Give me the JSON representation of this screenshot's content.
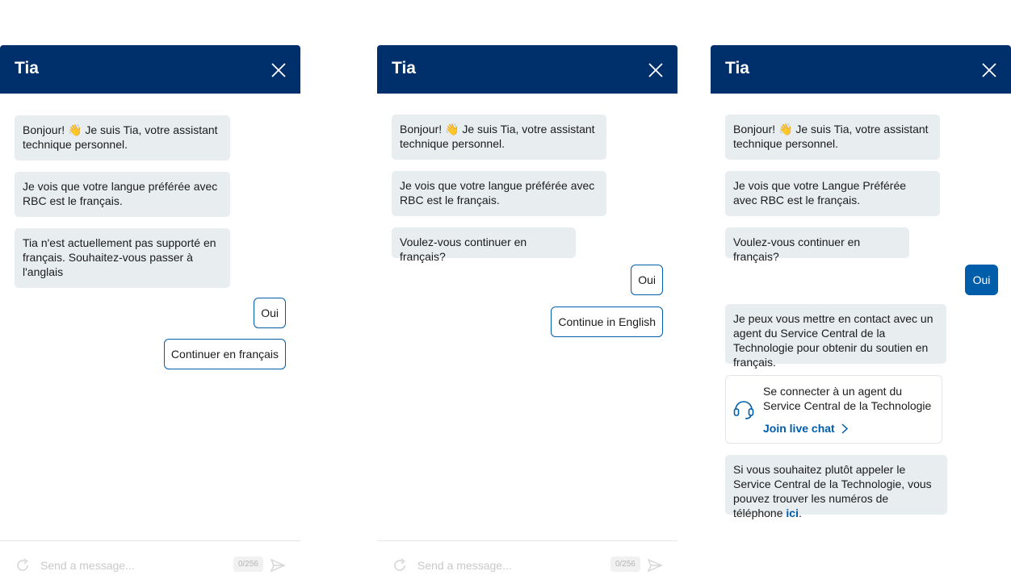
{
  "panels": [
    {
      "title": "Tia",
      "messages": [
        {
          "before": "Bonjour! ",
          "emoji": "👋",
          "after": " Je suis Tia, votre assistant technique personnel."
        },
        {
          "text": "Je vois que votre langue préférée avec RBC est le français."
        },
        {
          "text": "Tia n'est actuellement pas supporté en français. Souhaitez-vous passer à l'anglais"
        }
      ],
      "replies": [
        "Oui",
        "Continuer en français"
      ],
      "composer": {
        "placeholder": "Send a message...",
        "counter": "0/256"
      }
    },
    {
      "title": "Tia",
      "messages": [
        {
          "before": "Bonjour! ",
          "emoji": "👋",
          "after": " Je suis Tia, votre assistant technique personnel."
        },
        {
          "text": "Je vois que votre langue préférée avec RBC est le français."
        },
        {
          "text": "Voulez-vous continuer en français?"
        }
      ],
      "replies": [
        "Oui",
        "Continue in English"
      ],
      "composer": {
        "placeholder": "Send a message...",
        "counter": "0/256"
      }
    },
    {
      "title": "Tia",
      "messages": [
        {
          "before": "Bonjour! ",
          "emoji": "👋",
          "after": " Je suis Tia, votre assistant technique personnel."
        },
        {
          "text": "Je vois que votre Langue Préférée avec RBC est le français."
        },
        {
          "text": "Voulez-vous continuer en français?"
        },
        {
          "text": "Je peux vous mettre en contact avec un agent du Service Central de la Technologie pour obtenir du soutien en français."
        },
        {
          "before": "Si vous souhaitez plutôt appeler le  Service Central de la Technologie, vous pouvez trouver les numéros de téléphone ",
          "link": "ici",
          "after": "."
        }
      ],
      "replies": [
        "Oui"
      ],
      "card": {
        "text": "Se connecter à un agent du Service Central de la Technologie",
        "link": "Join live chat",
        "icon": "headset-icon"
      }
    }
  ],
  "colors": {
    "header": "#00306b",
    "accent": "#005daa",
    "bubble": "#e8edf0"
  }
}
